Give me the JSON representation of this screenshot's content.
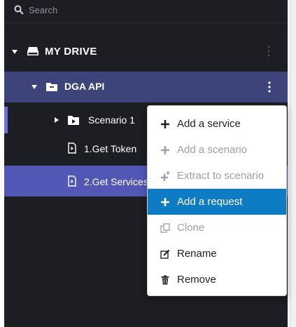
{
  "search": {
    "placeholder": "Search"
  },
  "tree": {
    "my_drive": {
      "label": "MY DRIVE",
      "icon": "drive-icon"
    },
    "project": {
      "label": "DGA API",
      "icon": "folder-icon"
    },
    "scenario": {
      "label": "Scenario 1",
      "icon": "scenario-folder-icon"
    },
    "requests": [
      {
        "label": "1.Get Token",
        "icon": "request-icon"
      },
      {
        "label": "2.Get Services",
        "icon": "request-icon"
      }
    ]
  },
  "context_menu": {
    "items": [
      {
        "label": "Add a service",
        "icon": "plus-icon",
        "state": "enabled"
      },
      {
        "label": "Add a scenario",
        "icon": "plus-icon",
        "state": "disabled"
      },
      {
        "label": "Extract to scenario",
        "icon": "extract-plus-icon",
        "state": "disabled"
      },
      {
        "label": "Add a request",
        "icon": "plus-icon",
        "state": "highlighted"
      },
      {
        "label": "Clone",
        "icon": "clone-icon",
        "state": "disabled"
      },
      {
        "label": "Rename",
        "icon": "edit-icon",
        "state": "enabled"
      },
      {
        "label": "Remove",
        "icon": "trash-icon",
        "state": "enabled"
      }
    ]
  },
  "colors": {
    "sidebar_bg": "#1c1e24",
    "project_row_bg": "#3d4479",
    "selected_row_bg": "#5257b5",
    "menu_highlight": "#0d7cc4",
    "accent_border": "#6b6fd8"
  }
}
